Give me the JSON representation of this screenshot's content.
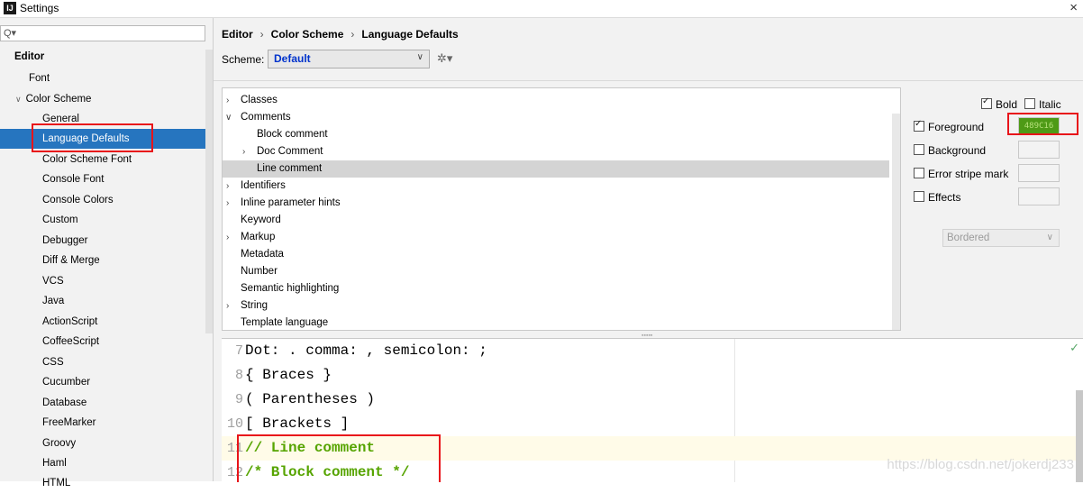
{
  "window": {
    "title": "Settings",
    "app_icon": "IJ"
  },
  "sidebar": {
    "search_placeholder": "",
    "items": [
      {
        "label": "Editor",
        "selected": false
      },
      {
        "label": "Font",
        "selected": false
      },
      {
        "label": "Color Scheme",
        "selected": false
      },
      {
        "label": "General",
        "selected": false
      },
      {
        "label": "Language Defaults",
        "selected": true
      },
      {
        "label": "Color Scheme Font",
        "selected": false
      },
      {
        "label": "Console Font",
        "selected": false
      },
      {
        "label": "Console Colors",
        "selected": false
      },
      {
        "label": "Custom",
        "selected": false
      },
      {
        "label": "Debugger",
        "selected": false
      },
      {
        "label": "Diff & Merge",
        "selected": false
      },
      {
        "label": "VCS",
        "selected": false
      },
      {
        "label": "Java",
        "selected": false
      },
      {
        "label": "ActionScript",
        "selected": false
      },
      {
        "label": "CoffeeScript",
        "selected": false
      },
      {
        "label": "CSS",
        "selected": false
      },
      {
        "label": "Cucumber",
        "selected": false
      },
      {
        "label": "Database",
        "selected": false
      },
      {
        "label": "FreeMarker",
        "selected": false
      },
      {
        "label": "Groovy",
        "selected": false
      },
      {
        "label": "Haml",
        "selected": false
      },
      {
        "label": "HTML",
        "selected": false
      }
    ]
  },
  "breadcrumb": {
    "parts": [
      "Editor",
      "Color Scheme",
      "Language Defaults"
    ],
    "separator": "›"
  },
  "scheme": {
    "label": "Scheme:",
    "value": "Default"
  },
  "categories": [
    {
      "label": "Classes",
      "expandable": true,
      "expanded": false
    },
    {
      "label": "Comments",
      "expandable": true,
      "expanded": true
    },
    {
      "label": "Block comment",
      "expandable": false
    },
    {
      "label": "Doc Comment",
      "expandable": true,
      "expanded": false
    },
    {
      "label": "Line comment",
      "expandable": false,
      "selected": true
    },
    {
      "label": "Identifiers",
      "expandable": true,
      "expanded": false
    },
    {
      "label": "Inline parameter hints",
      "expandable": true,
      "expanded": false
    },
    {
      "label": "Keyword",
      "expandable": false
    },
    {
      "label": "Markup",
      "expandable": true,
      "expanded": false
    },
    {
      "label": "Metadata",
      "expandable": false
    },
    {
      "label": "Number",
      "expandable": false
    },
    {
      "label": "Semantic highlighting",
      "expandable": false
    },
    {
      "label": "String",
      "expandable": true,
      "expanded": false
    },
    {
      "label": "Template language",
      "expandable": false
    }
  ],
  "attributes": {
    "bold": {
      "label": "Bold",
      "checked": true
    },
    "italic": {
      "label": "Italic",
      "checked": false
    },
    "foreground": {
      "label": "Foreground",
      "checked": true,
      "value": "489C16",
      "color": "#4e9a16"
    },
    "background": {
      "label": "Background",
      "checked": false
    },
    "error_stripe": {
      "label": "Error stripe mark",
      "checked": false
    },
    "effects": {
      "label": "Effects",
      "checked": false
    },
    "effect_type": "Bordered"
  },
  "preview": {
    "lines": [
      {
        "num": "7",
        "text": "Dot: . comma: , semicolon: ;",
        "comment": false
      },
      {
        "num": "8",
        "text": "{ Braces }",
        "comment": false
      },
      {
        "num": "9",
        "text": "( Parentheses )",
        "comment": false
      },
      {
        "num": "10",
        "text": "[ Brackets ]",
        "comment": false
      },
      {
        "num": "11",
        "text": "// Line comment",
        "comment": true
      },
      {
        "num": "12",
        "text": "/* Block comment */",
        "comment": true
      }
    ]
  },
  "watermark": "https://blog.csdn.net/jokerdj233",
  "colors": {
    "selection": "#2675bf",
    "comment": "#56a400",
    "highlight_box": "#e8141a"
  }
}
